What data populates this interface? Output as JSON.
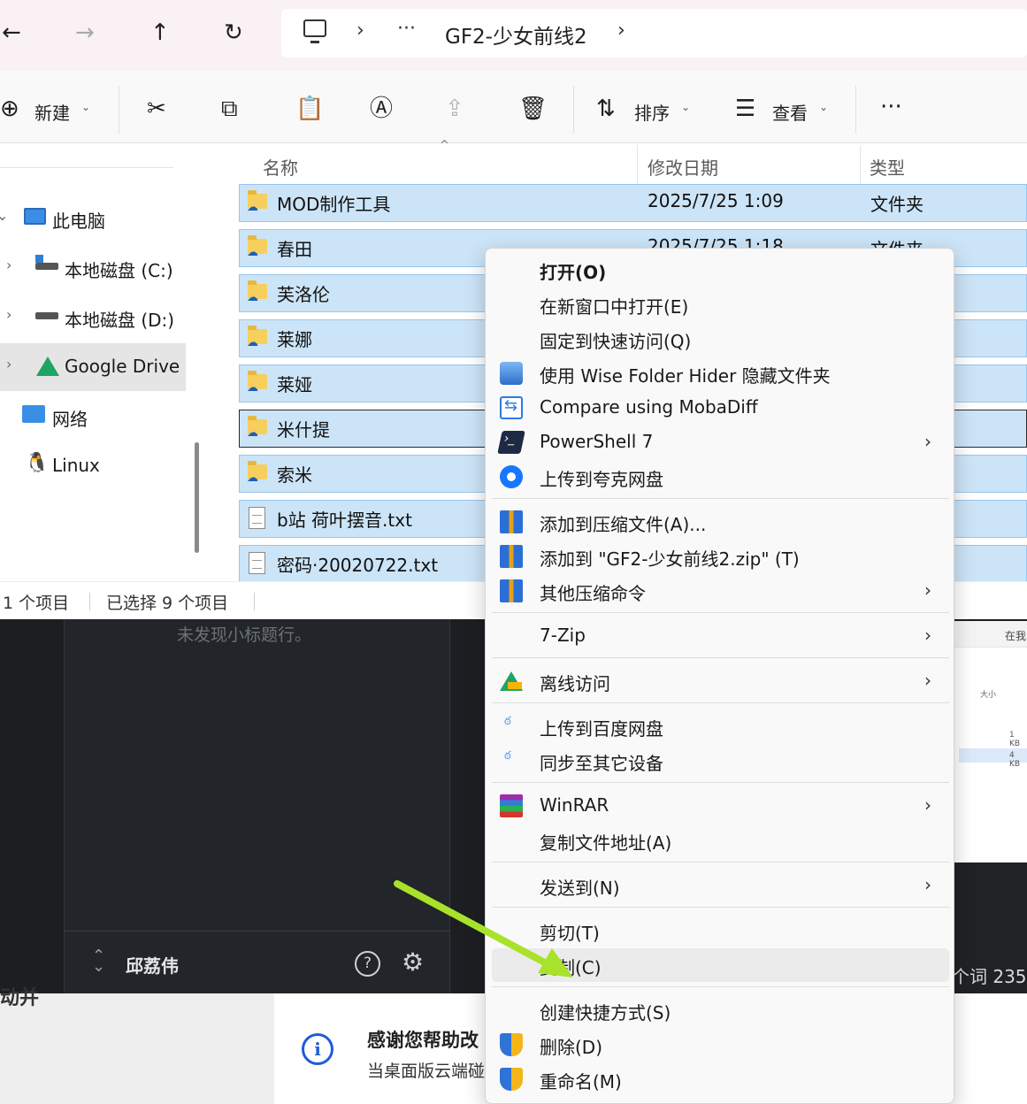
{
  "background": {
    "no_subtitle_text": "未发现小标题行。",
    "user_name": "邱荔伟",
    "help_icon": "?",
    "settings_icon": "⚙",
    "right_window": {
      "search": "在我",
      "size_header": "大小",
      "size1": "1 KB",
      "size2": "4 KB"
    },
    "word_count": "个词  235",
    "bottom_fragment": "动并",
    "info_icon": "i",
    "notice_title": "感谢您帮助改",
    "notice_body": "当桌面版云端碰"
  },
  "explorer": {
    "nav": {
      "back": "←",
      "forward": "→",
      "up": "↑",
      "refresh": "↻"
    },
    "address": {
      "sep1": "›",
      "more": "···",
      "path": "GF2-少女前线2",
      "sep2": "›"
    },
    "toolbar": {
      "new_icon": "⊕",
      "new_label": "新建",
      "caret": "⌄",
      "cut_icon": "✂",
      "copy_icon": "⧉",
      "paste_icon": "📋",
      "rename_icon": "Ⓐ",
      "share_icon": "⇪",
      "delete_icon": "🗑",
      "sort_icon": "⇅",
      "sort_label": "排序",
      "view_icon": "☰",
      "view_label": "查看",
      "more": "···"
    },
    "nav_pane": [
      {
        "label": "此电脑",
        "chevron": "⌄",
        "expanded": true
      },
      {
        "label": "本地磁盘 (C:)",
        "chevron": "›"
      },
      {
        "label": "本地磁盘 (D:)",
        "chevron": "›"
      },
      {
        "label": "Google Drive",
        "chevron": "›",
        "selected": true
      },
      {
        "label": "网络",
        "chevron": ""
      },
      {
        "label": "Linux",
        "chevron": ""
      }
    ],
    "columns": {
      "name": "名称",
      "date": "修改日期",
      "type": "类型",
      "sort_caret": "^"
    },
    "files": [
      {
        "name": "MOD制作工具",
        "date": "2025/7/25 1:09",
        "type": "文件夹",
        "kind": "folder"
      },
      {
        "name": "春田",
        "date": "2025/7/25 1:18",
        "type": "文件夹",
        "kind": "folder"
      },
      {
        "name": "芙洛伦",
        "date": "",
        "type": "",
        "kind": "folder"
      },
      {
        "name": "莱娜",
        "date": "",
        "type": "",
        "kind": "folder"
      },
      {
        "name": "莱娅",
        "date": "",
        "type": "",
        "kind": "folder"
      },
      {
        "name": "米什提",
        "date": "",
        "type": "",
        "kind": "folder"
      },
      {
        "name": "索米",
        "date": "",
        "type": "",
        "kind": "folder"
      },
      {
        "name": "b站 荷叶摆音.txt",
        "date": "",
        "type": "",
        "kind": "txt"
      },
      {
        "name": "密码·20020722.txt",
        "date": "",
        "type": "",
        "kind": "txt"
      }
    ],
    "status": {
      "count": "1 个项目",
      "selected": "已选择 9 个项目"
    }
  },
  "context_menu": {
    "arrow": "›",
    "items": [
      {
        "label": "打开(O)",
        "bold": true
      },
      {
        "label": "在新窗口中打开(E)"
      },
      {
        "label": "固定到快速访问(Q)"
      },
      {
        "label": "使用 Wise Folder Hider 隐藏文件夹",
        "icon": "wise-folder-hider-icon"
      },
      {
        "label": "Compare using MobaDiff",
        "icon": "mobadiff-icon"
      },
      {
        "label": "PowerShell 7",
        "icon": "powershell-icon",
        "submenu": true
      },
      {
        "label": "上传到夸克网盘",
        "icon": "quark-icon"
      },
      {
        "label": "添加到压缩文件(A)...",
        "icon": "winrar-archive-icon"
      },
      {
        "label": "添加到 \"GF2-少女前线2.zip\" (T)",
        "icon": "winrar-archive-icon"
      },
      {
        "label": "其他压缩命令",
        "icon": "winrar-archive-icon",
        "submenu": true
      },
      {
        "label": "7-Zip",
        "submenu": true
      },
      {
        "label": "离线访问",
        "icon": "google-drive-icon",
        "submenu": true
      },
      {
        "label": "上传到百度网盘",
        "icon": "baidu-netdisk-icon"
      },
      {
        "label": "同步至其它设备",
        "icon": "baidu-netdisk-icon"
      },
      {
        "label": "WinRAR",
        "icon": "winrar-icon",
        "submenu": true
      },
      {
        "label": "复制文件地址(A)"
      },
      {
        "label": "发送到(N)",
        "submenu": true
      },
      {
        "label": "剪切(T)"
      },
      {
        "label": "复制(C)",
        "hover": true
      },
      {
        "label": "创建快捷方式(S)"
      },
      {
        "label": "删除(D)",
        "icon": "uac-shield-icon"
      },
      {
        "label": "重命名(M)",
        "icon": "uac-shield-icon"
      }
    ]
  },
  "colors": {
    "selection": "#cce4f7",
    "arrow": "#a8e22a",
    "accent": "#1f5cd6"
  }
}
